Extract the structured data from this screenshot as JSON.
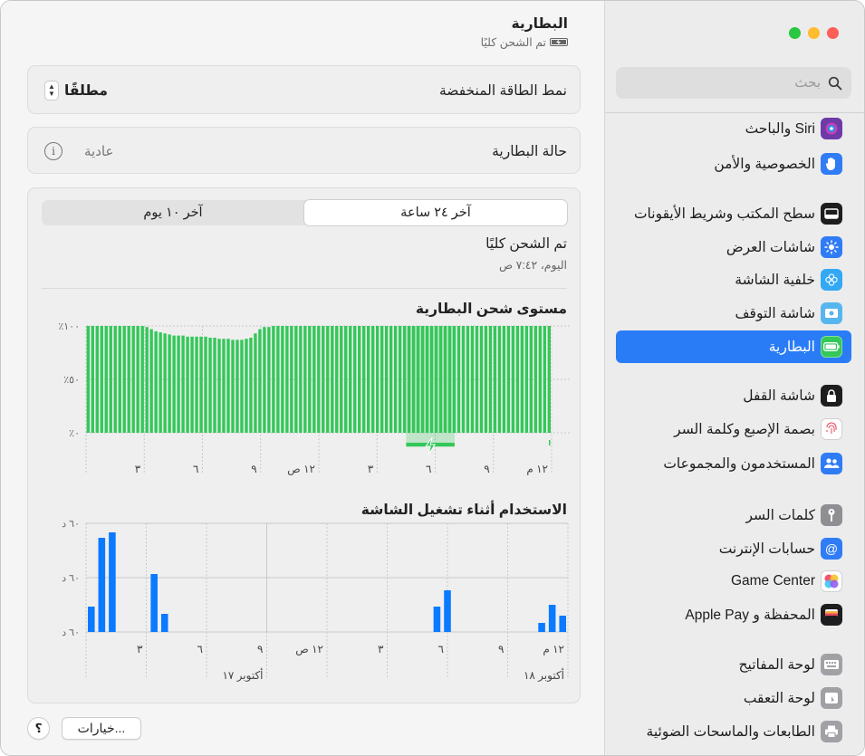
{
  "sidebar": {
    "search_placeholder": "بحث",
    "items": [
      {
        "label": "Siri والباحث",
        "icon": "siri-icon",
        "color": "#6d3aa8"
      },
      {
        "label": "الخصوصية والأمن",
        "icon": "hand-icon",
        "color": "#2f7cf6"
      },
      {
        "label": "سطح المكتب وشريط الأيقونات",
        "icon": "dock-icon",
        "color": "#1d1d1f"
      },
      {
        "label": "شاشات العرض",
        "icon": "brightness-icon",
        "color": "#2f7cf6"
      },
      {
        "label": "خلفية الشاشة",
        "icon": "wallpaper-icon",
        "color": "#33a9f5"
      },
      {
        "label": "شاشة التوقف",
        "icon": "screensaver-icon",
        "color": "#57b6ee"
      },
      {
        "label": "البطارية",
        "icon": "battery-icon",
        "color": "#34c759"
      },
      {
        "label": "شاشة القفل",
        "icon": "lock-icon",
        "color": "#1d1d1f"
      },
      {
        "label": "بصمة الإصبع وكلمة السر",
        "icon": "fingerprint-icon",
        "color": "#ffffff"
      },
      {
        "label": "المستخدمون والمجموعات",
        "icon": "users-icon",
        "color": "#2f7cf6"
      },
      {
        "label": "كلمات السر",
        "icon": "key-icon",
        "color": "#8e8e93"
      },
      {
        "label": "حسابات الإنترنت",
        "icon": "at-icon",
        "color": "#2f7cf6"
      },
      {
        "label": "Game Center",
        "icon": "game-center-icon",
        "color": "#ffffff"
      },
      {
        "label": "المحفظة و Apple Pay",
        "icon": "wallet-icon",
        "color": "#1d1d1f"
      },
      {
        "label": "لوحة المفاتيح",
        "icon": "keyboard-icon",
        "color": "#a0a0a5"
      },
      {
        "label": "لوحة التعقب",
        "icon": "trackpad-icon",
        "color": "#a0a0a5"
      },
      {
        "label": "الطابعات والماسحات الضوئية",
        "icon": "printer-icon",
        "color": "#a0a0a5"
      }
    ]
  },
  "header": {
    "title": "البطارية",
    "subtitle": "تم الشحن كليًا"
  },
  "low_power": {
    "label": "نمط الطاقة المنخفضة",
    "value": "مطلقًا"
  },
  "health": {
    "label": "حالة البطارية",
    "value": "عادية"
  },
  "tabs": {
    "last24": "آخر ٢٤ ساعة",
    "last10": "آخر ١٠ يوم"
  },
  "status": {
    "title": "تم الشحن كليًا",
    "time": "اليوم، ٧:٤٢ ص"
  },
  "buttons": {
    "options": "خيارات...",
    "help": "؟"
  },
  "colors": {
    "accent": "#2a7cf6",
    "battery_green": "#34c759",
    "usage_blue": "#0a7aff"
  },
  "chart_data": [
    {
      "type": "bar",
      "title": "مستوى شحن البطارية",
      "y_ticks": [
        "٪١٠٠",
        "٪٥٠",
        "٪٠"
      ],
      "x_ticks": [
        "٣",
        "٦",
        "٩",
        "١٢ ص",
        "٣",
        "٦",
        "٩",
        "١٢ م"
      ],
      "ylim": [
        0,
        100
      ],
      "values": [
        100,
        100,
        100,
        100,
        100,
        100,
        100,
        100,
        100,
        100,
        100,
        100,
        100,
        99,
        97,
        95,
        94,
        93,
        92,
        91,
        91,
        91,
        90,
        90,
        90,
        90,
        90,
        89,
        89,
        88,
        88,
        88,
        87,
        87,
        87,
        88,
        89,
        93,
        97,
        99,
        99,
        100,
        100,
        100,
        100,
        100,
        100,
        100,
        100,
        100,
        100,
        100,
        100,
        100,
        100,
        100,
        100,
        100,
        100,
        100,
        100,
        100,
        100,
        100,
        100,
        100,
        100,
        100,
        100,
        100,
        100,
        100,
        100,
        100,
        100,
        100,
        100,
        100,
        100,
        100,
        100,
        100,
        100,
        100,
        100,
        100,
        100,
        100,
        100,
        100,
        100,
        100,
        100,
        100,
        100,
        100,
        100,
        100,
        100,
        100,
        100,
        100,
        100
      ],
      "charging_hours": [
        16.5,
        19
      ]
    },
    {
      "type": "bar",
      "title": "الاستخدام أثناء تشغيل الشاشة",
      "y_ticks": [
        "٦٠ د",
        "٦٠ د",
        "٦٠ د"
      ],
      "x_ticks": [
        "٣",
        "٦",
        "٩",
        "١٢ ص",
        "٣",
        "٦",
        "٩",
        "١٢ م"
      ],
      "date_labels": [
        "أكتوبر ١٧",
        "أكتوبر ١٨"
      ],
      "ylim": [
        0,
        60
      ],
      "values": [
        14,
        52,
        55,
        0,
        0,
        0,
        32,
        10,
        0,
        0,
        0,
        0,
        0,
        0,
        0,
        0,
        0,
        0,
        0,
        0,
        0,
        0,
        0,
        0,
        0,
        0,
        0,
        0,
        0,
        0,
        0,
        0,
        0,
        14,
        23,
        0,
        0,
        0,
        0,
        0,
        0,
        0,
        0,
        5,
        15,
        9
      ]
    }
  ]
}
